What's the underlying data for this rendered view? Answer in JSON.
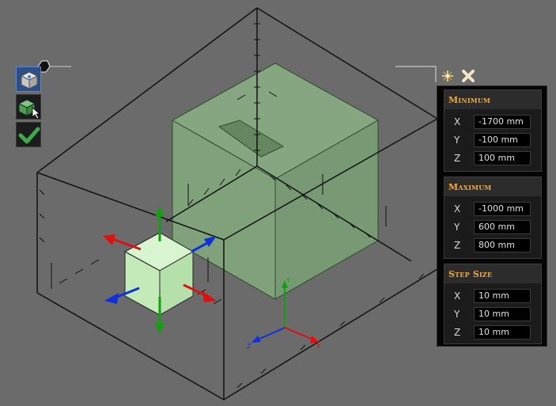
{
  "toolbar": {
    "buttons": [
      {
        "name": "view-cube",
        "active": true
      },
      {
        "name": "select-box",
        "active": false
      },
      {
        "name": "confirm",
        "active": false
      }
    ]
  },
  "panel": {
    "sections": [
      {
        "title": "Minimum",
        "rows": [
          {
            "axis": "X",
            "value": "-1700 mm"
          },
          {
            "axis": "Y",
            "value": "-100 mm"
          },
          {
            "axis": "Z",
            "value": "100 mm"
          }
        ]
      },
      {
        "title": "Maximum",
        "rows": [
          {
            "axis": "X",
            "value": "-1000 mm"
          },
          {
            "axis": "Y",
            "value": "600 mm"
          },
          {
            "axis": "Z",
            "value": "800 mm"
          }
        ]
      },
      {
        "title": "Step Size",
        "rows": [
          {
            "axis": "X",
            "value": "10 mm"
          },
          {
            "axis": "Y",
            "value": "10 mm"
          },
          {
            "axis": "Z",
            "value": "10 mm"
          }
        ]
      }
    ]
  },
  "axis_triad": {
    "y_label": "Y",
    "z_label": "Z",
    "x_label": "X"
  },
  "colors": {
    "background": "#6b6b6b",
    "box_fill": "#8fb98a",
    "handle_fill": "#c8f0c0",
    "gizmo_red": "#e01010",
    "gizmo_green": "#10a010",
    "gizmo_blue": "#1030e0",
    "section_title": "#f2a93b"
  }
}
